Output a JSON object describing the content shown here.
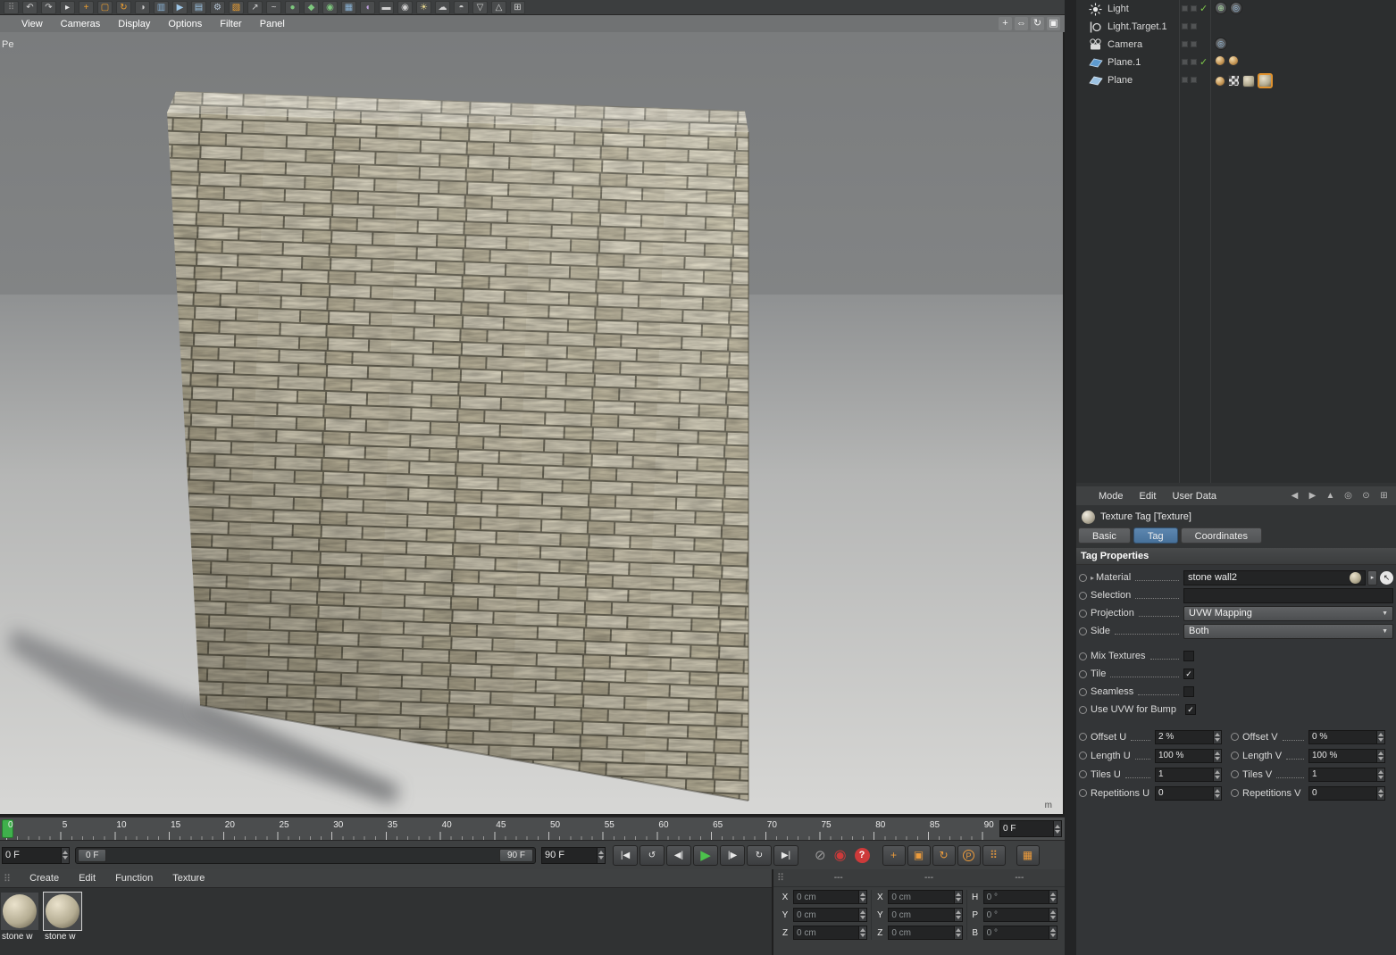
{
  "colors": {
    "accent_orange": "#e0922f",
    "tab_active_blue": "#47719a",
    "play_green": "#4cc24c",
    "playhead_green": "#3fb04c",
    "record_red": "#cd3a3a",
    "check_green": "#7ec84a"
  },
  "icons": {
    "check": "✓",
    "expander": "▸",
    "dropdown_arrow": "▼",
    "pick_arrow": "↖",
    "drag_handle": "⠿"
  },
  "top_toolbar": {
    "icons": [
      {
        "name": "drag-handle",
        "glyph": "⠿",
        "color": "#8a8a8a"
      },
      {
        "name": "undo",
        "glyph": "↶",
        "color": "#d0d0d0"
      },
      {
        "name": "redo",
        "glyph": "↷",
        "color": "#d0d0d0"
      },
      {
        "name": "live-selection",
        "glyph": "▸",
        "color": "#e8e8e8"
      },
      {
        "name": "move-tool",
        "glyph": "+",
        "color": "#f0a030"
      },
      {
        "name": "scale-tool",
        "glyph": "▢",
        "color": "#f0a030"
      },
      {
        "name": "rotate-tool",
        "glyph": "↻",
        "color": "#f0a030"
      },
      {
        "name": "last-tool",
        "glyph": "◑",
        "color": "#d0d0d0"
      },
      {
        "name": "coordinate-system",
        "glyph": "▥",
        "color": "#8ab4d8"
      },
      {
        "name": "render-view",
        "glyph": "▶",
        "color": "#9ec7e8"
      },
      {
        "name": "render-picture-viewer",
        "glyph": "▤",
        "color": "#9ec7e8"
      },
      {
        "name": "render-settings",
        "glyph": "⚙",
        "color": "#b8c8d8"
      },
      {
        "name": "primitive-cube",
        "glyph": "▧",
        "color": "#f0a030"
      },
      {
        "name": "pen-tool",
        "glyph": "↗",
        "color": "#d0d0d0"
      },
      {
        "name": "spline-tool",
        "glyph": "~",
        "color": "#d0d0d0"
      },
      {
        "name": "subdivision-surface",
        "glyph": "●",
        "color": "#7ec87e"
      },
      {
        "name": "extrude-object",
        "glyph": "◆",
        "color": "#7ec87e"
      },
      {
        "name": "lathe-object",
        "glyph": "◉",
        "color": "#7ec87e"
      },
      {
        "name": "array-object",
        "glyph": "▦",
        "color": "#8ab4d8"
      },
      {
        "name": "deformer",
        "glyph": "◖",
        "color": "#c0a0e0"
      },
      {
        "name": "floor-object",
        "glyph": "▬",
        "color": "#d0d0d0"
      },
      {
        "name": "camera-object",
        "glyph": "◉",
        "color": "#d0d0d0"
      },
      {
        "name": "light-object",
        "glyph": "☀",
        "color": "#e8d890"
      },
      {
        "name": "sky-object",
        "glyph": "☁",
        "color": "#d0d0d0"
      },
      {
        "name": "environment-object",
        "glyph": "◓",
        "color": "#d0d0d0"
      },
      {
        "name": "selection-filter",
        "glyph": "▽",
        "color": "#d0d0d0"
      },
      {
        "name": "snap-settings",
        "glyph": "△",
        "color": "#d0d0d0"
      },
      {
        "name": "grid-options",
        "glyph": "⊞",
        "color": "#d0d0d0"
      }
    ]
  },
  "viewport": {
    "menu": [
      {
        "label": "View"
      },
      {
        "label": "Cameras"
      },
      {
        "label": "Display"
      },
      {
        "label": "Options"
      },
      {
        "label": "Filter"
      },
      {
        "label": "Panel"
      }
    ],
    "camera_label": "Pe",
    "unit_label": "m",
    "nav_icons": [
      {
        "name": "pan-view-icon",
        "glyph": "+"
      },
      {
        "name": "zoom-view-icon",
        "glyph": "⇔"
      },
      {
        "name": "rotate-view-icon",
        "glyph": "↻"
      },
      {
        "name": "toggle-view-icon",
        "glyph": "▣"
      }
    ]
  },
  "object_manager": {
    "objects": [
      {
        "name": "Light",
        "type": "light",
        "enabled": true,
        "tags": [
          "target-expression-tag",
          "expression-tag"
        ]
      },
      {
        "name": "Light.Target.1",
        "type": "null-target",
        "enabled": null,
        "tags": []
      },
      {
        "name": "Camera",
        "type": "camera",
        "enabled": null,
        "tags": [
          "target-expression-tag"
        ]
      },
      {
        "name": "Plane.1",
        "type": "plane",
        "enabled": true,
        "tags": [
          "phong-tag",
          "phong-tag"
        ]
      },
      {
        "name": "Plane",
        "type": "plane",
        "enabled": null,
        "tags": [
          "phong-tag",
          "uvw-tag",
          "texture-tag",
          "texture-tag-selected"
        ]
      }
    ]
  },
  "attribute_manager": {
    "menu": [
      {
        "label": "Mode"
      },
      {
        "label": "Edit"
      },
      {
        "label": "User Data"
      }
    ],
    "header_icons": [
      {
        "name": "history-back",
        "glyph": "◀"
      },
      {
        "name": "history-forward",
        "glyph": "▶"
      },
      {
        "name": "parent-up",
        "glyph": "▲"
      },
      {
        "name": "search",
        "glyph": "◎"
      },
      {
        "name": "lock",
        "glyph": "⊙"
      },
      {
        "name": "new-panel",
        "glyph": "⊞"
      }
    ],
    "title": "Texture Tag [Texture]",
    "tabs": [
      {
        "label": "Basic",
        "active": false
      },
      {
        "label": "Tag",
        "active": true
      },
      {
        "label": "Coordinates",
        "active": false
      }
    ],
    "section_title": "Tag Properties",
    "rows": {
      "material": {
        "label": "Material",
        "value": "stone wall2"
      },
      "selection": {
        "label": "Selection",
        "value": ""
      },
      "projection": {
        "label": "Projection",
        "value": "UVW Mapping"
      },
      "side": {
        "label": "Side",
        "value": "Both"
      }
    },
    "checkbox_rows": [
      {
        "label": "Mix Textures",
        "checked": false
      },
      {
        "label": "Tile",
        "checked": true
      },
      {
        "label": "Seamless",
        "checked": false
      },
      {
        "label": "Use UVW for Bump",
        "checked": true
      }
    ],
    "uv_rows": [
      {
        "left_label": "Offset U",
        "left_value": "2 %",
        "right_label": "Offset V",
        "right_value": "0 %"
      },
      {
        "left_label": "Length U",
        "left_value": "100 %",
        "right_label": "Length V",
        "right_value": "100 %"
      },
      {
        "left_label": "Tiles U",
        "left_value": "1",
        "right_label": "Tiles V",
        "right_value": "1"
      },
      {
        "left_label": "Repetitions U",
        "left_value": "0",
        "right_label": "Repetitions V",
        "right_value": "0"
      }
    ]
  },
  "timeline": {
    "tick_labels": [
      "0",
      "5",
      "10",
      "15",
      "20",
      "25",
      "30",
      "35",
      "40",
      "45",
      "50",
      "55",
      "60",
      "65",
      "70",
      "75",
      "80",
      "85",
      "90"
    ],
    "current_frame": 0,
    "current_frame_display": "0 F"
  },
  "transport": {
    "current_frame_field": "0 F",
    "range_start_label": "0 F",
    "range_end_label": "90 F",
    "end_frame_field": "90 F",
    "buttons": [
      {
        "name": "goto-start-button",
        "glyph": "|◀"
      },
      {
        "name": "play-backwards-button",
        "glyph": "↺"
      },
      {
        "name": "previous-frame-button",
        "glyph": "◀|"
      },
      {
        "name": "play-button",
        "glyph": "▶"
      },
      {
        "name": "next-frame-button",
        "glyph": "|▶"
      },
      {
        "name": "play-loop-button",
        "glyph": "↻"
      },
      {
        "name": "goto-end-button",
        "glyph": "▶|"
      }
    ],
    "record_buttons": [
      {
        "name": "record-disabled-button",
        "glyph": "⊘"
      },
      {
        "name": "keyframe-record-button",
        "glyph": "◉"
      },
      {
        "name": "autokey-button",
        "glyph": "?"
      }
    ],
    "key_buttons": [
      {
        "name": "key-position-button",
        "glyph": "+"
      },
      {
        "name": "key-scale-button",
        "glyph": "▣"
      },
      {
        "name": "key-rotation-button",
        "glyph": "↻"
      },
      {
        "name": "key-parameter-button",
        "glyph": "P"
      },
      {
        "name": "key-pla-button",
        "glyph": "⠿"
      }
    ],
    "keyframe_selection_glyph": "▦"
  },
  "material_manager": {
    "menu": [
      {
        "label": "Create"
      },
      {
        "label": "Edit"
      },
      {
        "label": "Function"
      },
      {
        "label": "Texture"
      }
    ],
    "materials": [
      {
        "label": "stone w",
        "selected": false
      },
      {
        "label": "stone w",
        "selected": true
      }
    ]
  },
  "coordinate_manager": {
    "column_headers": [
      "---",
      "---",
      "---"
    ],
    "position": [
      {
        "axis": "X",
        "value": "0 cm"
      },
      {
        "axis": "Y",
        "value": "0 cm"
      },
      {
        "axis": "Z",
        "value": "0 cm"
      }
    ],
    "scale": [
      {
        "axis": "X",
        "value": "0 cm"
      },
      {
        "axis": "Y",
        "value": "0 cm"
      },
      {
        "axis": "Z",
        "value": "0 cm"
      }
    ],
    "rotation": [
      {
        "axis": "H",
        "value": "0 °"
      },
      {
        "axis": "P",
        "value": "0 °"
      },
      {
        "axis": "B",
        "value": "0 °"
      }
    ]
  }
}
